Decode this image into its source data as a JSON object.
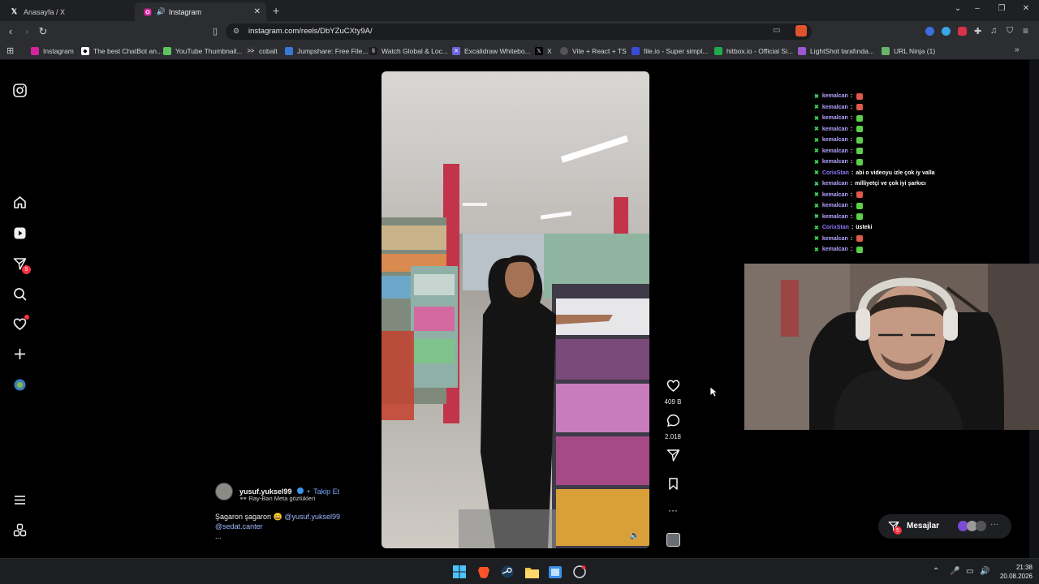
{
  "browser": {
    "tabs": [
      {
        "title": "Anasayfa / X",
        "icon": "x-logo-icon"
      },
      {
        "title": "Instagram",
        "icon": "instagram-icon",
        "audio": true
      }
    ],
    "url": "instagram.com/reels/DbYZuCXty9A/",
    "bookmarks": [
      {
        "label": "Instagram",
        "icon": "instagram-icon",
        "color": "#d6249f"
      },
      {
        "label": "The best ChatBot an...",
        "icon": "chatbot-icon",
        "color": "#ffffff"
      },
      {
        "label": "YouTube Thumbnail...",
        "icon": "thumbnail-icon",
        "color": "#5fc35f"
      },
      {
        "label": "cobalt",
        "icon": "cobalt-icon",
        "color": "#dddddd"
      },
      {
        "label": "Jumpshare: Free File...",
        "icon": "jumpshare-icon",
        "color": "#3a78d8"
      },
      {
        "label": "Watch Global & Loc...",
        "icon": "watch-icon",
        "color": "#1c1c1c"
      },
      {
        "label": "Excalidraw Whitebo...",
        "icon": "excalidraw-icon",
        "color": "#6965db"
      },
      {
        "label": "X",
        "icon": "x-logo-icon",
        "color": "#000000"
      },
      {
        "label": "Vite + React + TS",
        "icon": "globe-icon",
        "color": "#666666"
      },
      {
        "label": "file.io - Super simpl...",
        "icon": "fileio-icon",
        "color": "#3b4bd8"
      },
      {
        "label": "hitbox.io - Official Si...",
        "icon": "hitbox-icon",
        "color": "#1faa4d"
      },
      {
        "label": "LightShot tarafında...",
        "icon": "lightshot-icon",
        "color": "#9b59d0"
      },
      {
        "label": "URL Ninja (1)",
        "icon": "ninja-icon",
        "color": "#6bb36b"
      }
    ]
  },
  "sidebar": {
    "items": [
      {
        "name": "home",
        "icon": "home-icon"
      },
      {
        "name": "reels",
        "icon": "reels-icon"
      },
      {
        "name": "messages",
        "icon": "send-icon",
        "badge": "5"
      },
      {
        "name": "search",
        "icon": "search-icon"
      },
      {
        "name": "notifications",
        "icon": "heart-icon"
      },
      {
        "name": "create",
        "icon": "plus-icon"
      },
      {
        "name": "profile",
        "icon": "avatar"
      }
    ]
  },
  "reel": {
    "likes": "409 B",
    "comments": "2.018",
    "author": "yusuf.yuksel99",
    "follow_label": "Takip Et",
    "separator": "•",
    "subtitle": "Ray-Ban Meta gözlükleri",
    "caption_text": "Şagaron şagaron",
    "caption_mention_1": "@yusuf.yuksel99",
    "caption_mention_2": "@sedat.canter",
    "more": "..."
  },
  "chat": {
    "lines": [
      {
        "user": "kemalcan",
        "color": "#b2a6ff",
        "msg": "",
        "emote": "#e05a4a"
      },
      {
        "user": "kemalcan",
        "color": "#b2a6ff",
        "msg": "",
        "emote": "#e05a4a"
      },
      {
        "user": "kemalcan",
        "color": "#b2a6ff",
        "msg": "",
        "emote": "#5ccf4a"
      },
      {
        "user": "kemalcan",
        "color": "#b2a6ff",
        "msg": "",
        "emote": "#5ccf4a"
      },
      {
        "user": "kemalcan",
        "color": "#b2a6ff",
        "msg": "",
        "emote": "#5ccf4a"
      },
      {
        "user": "kemalcan",
        "color": "#b2a6ff",
        "msg": "",
        "emote": "#5ccf4a"
      },
      {
        "user": "kemalcan",
        "color": "#b2a6ff",
        "msg": "",
        "emote": "#5ccf4a"
      },
      {
        "user": "CorixStan",
        "color": "#8b7cff",
        "msg": "abi o videoyu izle çok iy valla",
        "emote": ""
      },
      {
        "user": "kemalcan",
        "color": "#b2a6ff",
        "msg": "milliyetçi ve çok iyi şarkıcı",
        "emote": ""
      },
      {
        "user": "kemalcan",
        "color": "#b2a6ff",
        "msg": "",
        "emote": "#e05a4a"
      },
      {
        "user": "kemalcan",
        "color": "#b2a6ff",
        "msg": "",
        "emote": "#5ccf4a"
      },
      {
        "user": "kemalcan",
        "color": "#b2a6ff",
        "msg": "",
        "emote": "#5ccf4a"
      },
      {
        "user": "CorixStan",
        "color": "#8b7cff",
        "msg": "üsteki",
        "emote": ""
      },
      {
        "user": "kemalcan",
        "color": "#b2a6ff",
        "msg": "",
        "emote": "#e05a4a"
      },
      {
        "user": "kemalcan",
        "color": "#b2a6ff",
        "msg": "",
        "emote": "#5ccf4a"
      }
    ]
  },
  "messages_button": {
    "label": "Mesajlar",
    "badge": "5"
  },
  "taskbar": {
    "time": "21:38",
    "date": "20.08.2026"
  }
}
